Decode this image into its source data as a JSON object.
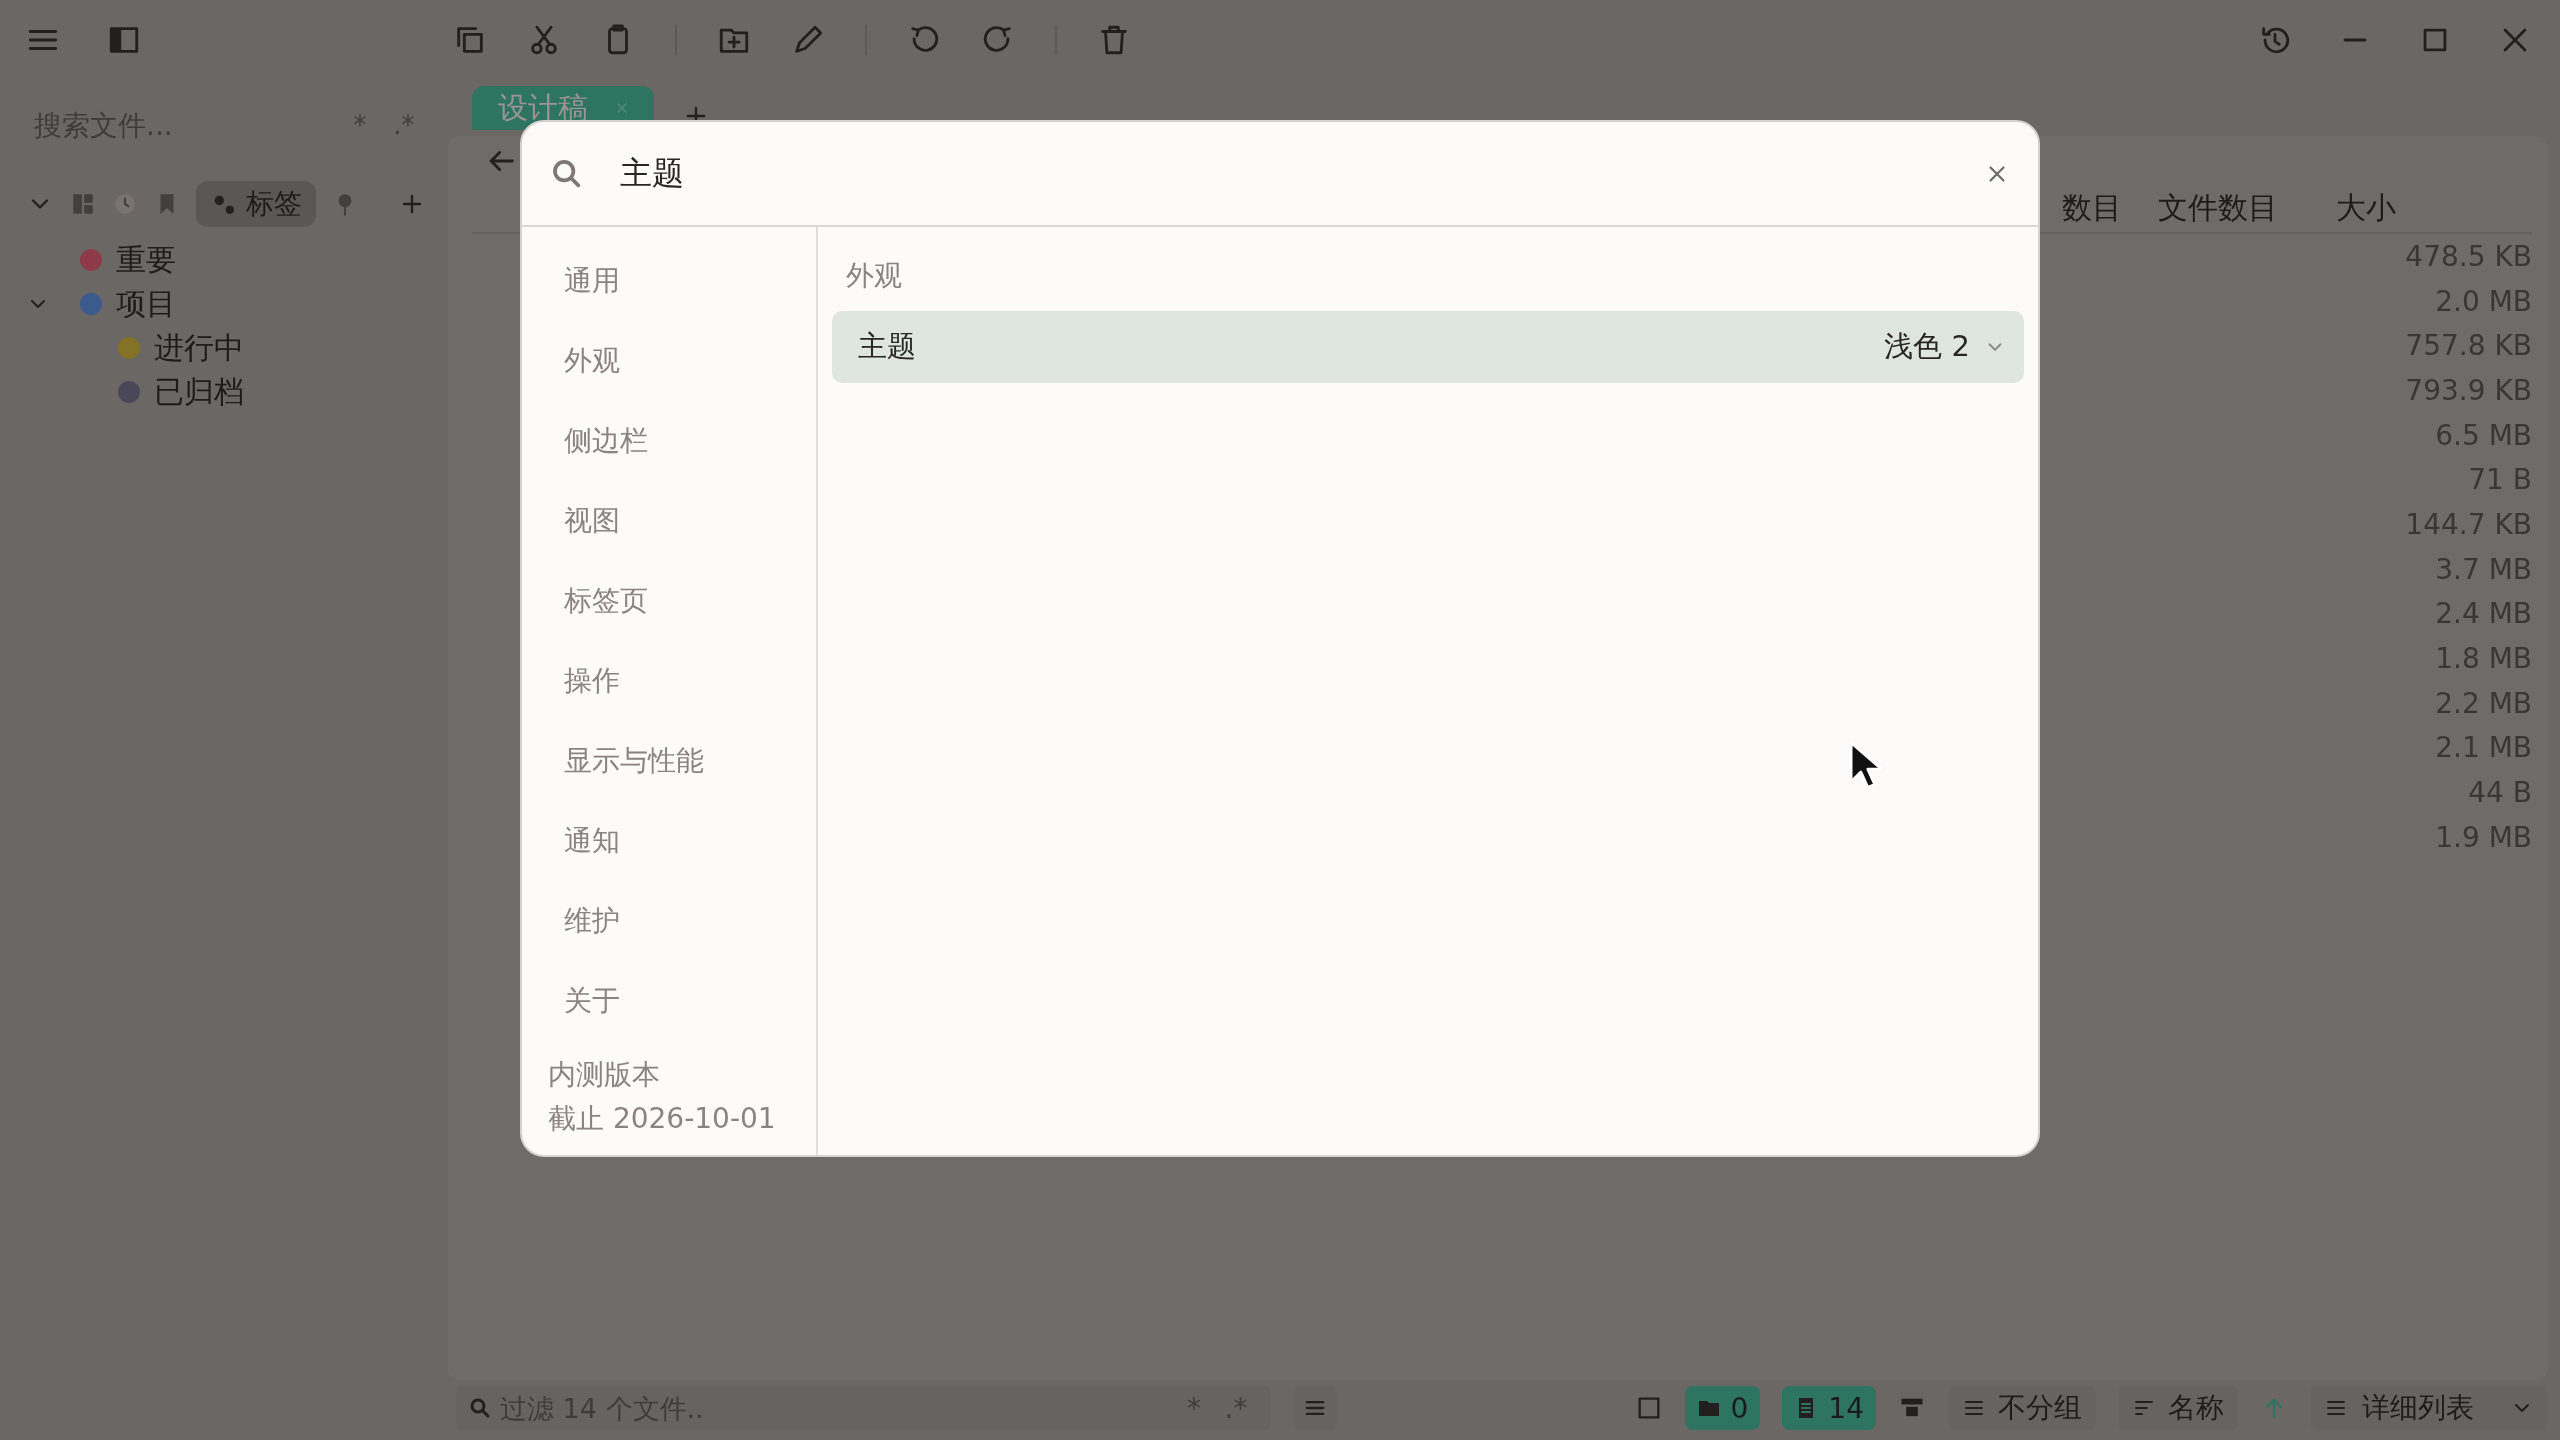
{
  "tabs": [
    {
      "label": "设计稿",
      "selected": true
    }
  ],
  "sidebar": {
    "search": {
      "placeholder": "搜索文件...",
      "options": [
        "*",
        ".*"
      ]
    },
    "views": [
      {
        "kind": "grid",
        "selected": false
      },
      {
        "kind": "recent",
        "selected": false
      },
      {
        "kind": "bookmarks",
        "selected": false
      },
      {
        "kind": "tags",
        "label": "标签",
        "selected": true
      },
      {
        "kind": "pin",
        "selected": false
      }
    ],
    "tags": [
      {
        "label": "重要",
        "color": "#8e3a48"
      },
      {
        "label": "项目",
        "color": "#3c5a8e",
        "expanded": true,
        "children": [
          {
            "label": "进行中",
            "color": "#847226"
          },
          {
            "label": "已归档",
            "color": "#4a4858"
          }
        ]
      }
    ]
  },
  "file_list": {
    "columns": [
      "数目",
      "文件数目",
      "大小"
    ],
    "sizes": [
      "478.5 KB",
      "2.0 MB",
      "757.8 KB",
      "793.9 KB",
      "6.5 MB",
      "71 B",
      "144.7 KB",
      "3.7 MB",
      "2.4 MB",
      "1.8 MB",
      "2.2 MB",
      "2.1 MB",
      "44 B",
      "1.9 MB"
    ]
  },
  "status_bar": {
    "filter": {
      "placeholder": "过滤 14 个文件..",
      "options": [
        "*",
        ".*"
      ]
    },
    "select_all": false,
    "folder_count": "0",
    "file_count": "14",
    "group": "不分组",
    "sort": "名称",
    "sort_ascending": true,
    "view": "详细列表"
  },
  "settings_dialog": {
    "search": {
      "value": "主题"
    },
    "nav": [
      "通用",
      "外观",
      "侧边栏",
      "视图",
      "标签页",
      "操作",
      "显示与性能",
      "通知",
      "维护",
      "关于"
    ],
    "footer": [
      "内测版本",
      "截止 2026-10-01"
    ],
    "section": "外观",
    "rows": [
      {
        "kind": "dropdown",
        "label": "主题",
        "value": "浅色 2",
        "highlighted": true
      }
    ]
  }
}
